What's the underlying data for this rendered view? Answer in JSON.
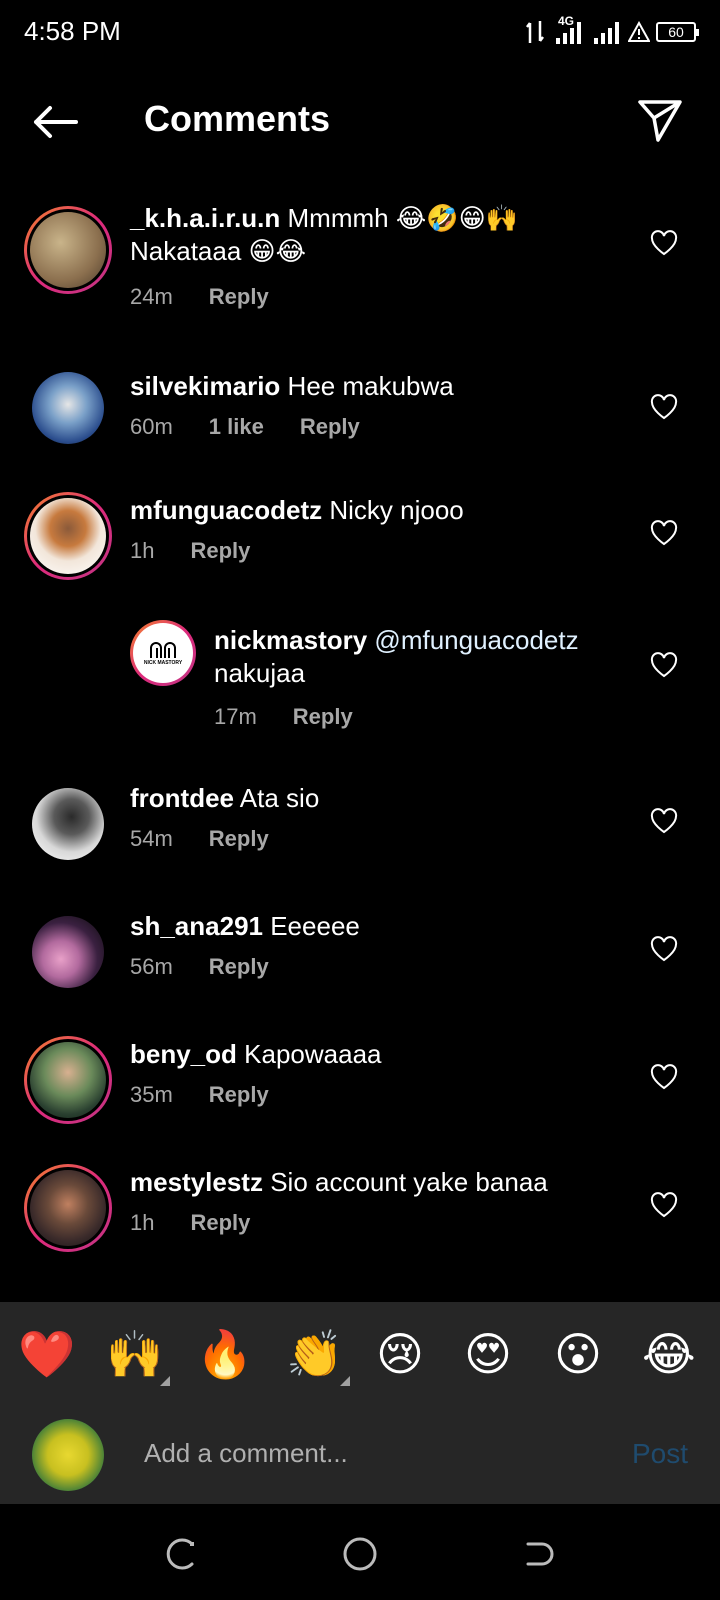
{
  "status_bar": {
    "time": "4:58 PM",
    "network": "4G",
    "battery": "60"
  },
  "header": {
    "title": "Comments"
  },
  "comments": [
    {
      "user": "_k.h.a.i.r.u.n",
      "text": "Mmmmh 😂🤣😁🙌",
      "text2": "Nakataaa 😁😂",
      "time": "24m",
      "likes": "",
      "reply": "Reply"
    },
    {
      "user": "silvekimario",
      "text": "Hee makubwa",
      "time": "60m",
      "likes": "1 like",
      "reply": "Reply"
    },
    {
      "user": "mfunguacodetz",
      "text": "Nicky njooo",
      "time": "1h",
      "likes": "",
      "reply": "Reply"
    },
    {
      "user": "nickmastory",
      "text": "@mfunguacodetz",
      "text2": "nakujaa",
      "time": "17m",
      "likes": "",
      "reply": "Reply",
      "avatar_text": "NICK MASTORY"
    },
    {
      "user": "frontdee",
      "text": "Ata sio",
      "time": "54m",
      "likes": "",
      "reply": "Reply"
    },
    {
      "user": "sh_ana291",
      "text": "Eeeeee",
      "time": "56m",
      "likes": "",
      "reply": "Reply"
    },
    {
      "user": "beny_od",
      "text": "Kapowaaaa",
      "time": "35m",
      "likes": "",
      "reply": "Reply"
    },
    {
      "user": "mestylestz",
      "text": "Sio account yake banaa",
      "time": "1h",
      "likes": "",
      "reply": "Reply"
    }
  ],
  "emoji_bar": [
    "❤️",
    "🙌",
    "🔥",
    "👏",
    "😢",
    "😍",
    "😮",
    "😂"
  ],
  "composer": {
    "placeholder": "Add a comment...",
    "post_label": "Post"
  },
  "colors": {
    "background": "#000000",
    "panel": "#262626",
    "muted": "#a8a8a8",
    "post_disabled": "#1f4b6e",
    "story_ring": "#dd2a7b"
  },
  "icons": {
    "back": "arrow-left-icon",
    "share": "paper-plane-icon",
    "like": "heart-outline-icon",
    "nav": [
      "recents-icon",
      "home-circle-icon",
      "back-nav-icon"
    ]
  }
}
